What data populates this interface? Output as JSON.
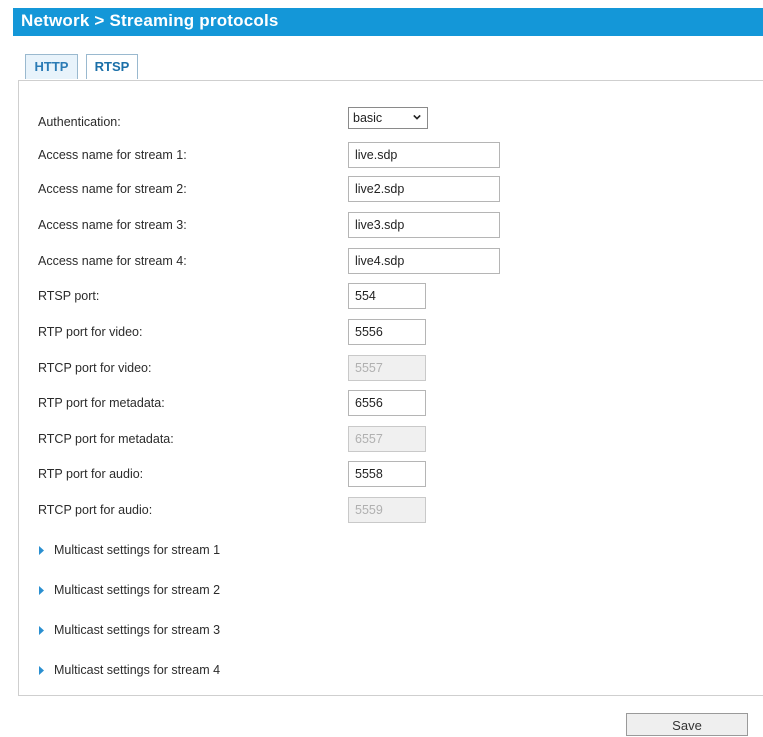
{
  "header": {
    "title": "Network > Streaming protocols"
  },
  "tabs": [
    {
      "label": "HTTP"
    },
    {
      "label": "RTSP"
    }
  ],
  "form": {
    "authentication": {
      "label": "Authentication:",
      "value": "basic"
    },
    "stream1": {
      "label": "Access name for stream 1:",
      "value": "live.sdp"
    },
    "stream2": {
      "label": "Access name for stream 2:",
      "value": "live2.sdp"
    },
    "stream3": {
      "label": "Access name for stream 3:",
      "value": "live3.sdp"
    },
    "stream4": {
      "label": "Access name for stream 4:",
      "value": "live4.sdp"
    },
    "rtsp_port": {
      "label": "RTSP port:",
      "value": "554"
    },
    "rtp_video": {
      "label": "RTP port for video:",
      "value": "5556"
    },
    "rtcp_video": {
      "label": "RTCP port for video:",
      "value": "5557"
    },
    "rtp_meta": {
      "label": "RTP port for metadata:",
      "value": "6556"
    },
    "rtcp_meta": {
      "label": "RTCP port for metadata:",
      "value": "6557"
    },
    "rtp_audio": {
      "label": "RTP port for audio:",
      "value": "5558"
    },
    "rtcp_audio": {
      "label": "RTCP port for audio:",
      "value": "5559"
    }
  },
  "multicast": [
    {
      "label": "Multicast settings for stream 1"
    },
    {
      "label": "Multicast settings for stream 2"
    },
    {
      "label": "Multicast settings for stream 3"
    },
    {
      "label": "Multicast settings for stream 4"
    }
  ],
  "footer": {
    "save_label": "Save"
  },
  "colors": {
    "header_bg": "#1497d8",
    "tab_text": "#1a6fa8",
    "arrow": "#2a8fd0"
  },
  "icons": {
    "dropdown": "chevron-down-icon",
    "expand": "triangle-right-icon"
  }
}
